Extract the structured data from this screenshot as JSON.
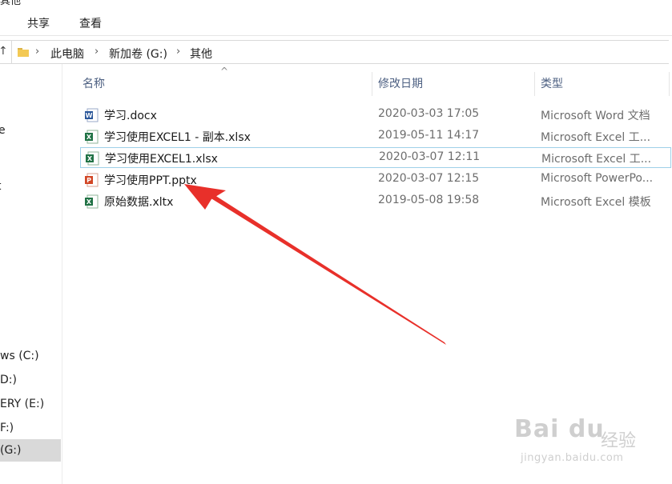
{
  "window": {
    "title_fragment": "其他"
  },
  "ribbon": {
    "tabs": [
      "共享",
      "查看"
    ]
  },
  "address": {
    "breadcrumbs": [
      "此电脑",
      "新加卷 (G:)",
      "其他"
    ]
  },
  "sidebar": {
    "fragments": [
      "e",
      "t"
    ],
    "drives": [
      {
        "label": "ws (C:)",
        "selected": false
      },
      {
        "label": "D:)",
        "selected": false
      },
      {
        "label": "ERY (E:)",
        "selected": false
      },
      {
        "label": "F:)",
        "selected": false
      },
      {
        "label": "(G:)",
        "selected": true
      }
    ]
  },
  "columns": {
    "name": "名称",
    "date": "修改日期",
    "type": "类型"
  },
  "files": [
    {
      "name": "学习.docx",
      "date": "2020-03-03 17:05",
      "type": "Microsoft Word 文档",
      "icon": "word-icon",
      "focused": false
    },
    {
      "name": "学习使用EXCEL1 - 副本.xlsx",
      "date": "2019-05-11 14:17",
      "type": "Microsoft Excel 工...",
      "icon": "excel-icon",
      "focused": false
    },
    {
      "name": "学习使用EXCEL1.xlsx",
      "date": "2020-03-07 12:11",
      "type": "Microsoft Excel 工...",
      "icon": "excel-icon",
      "focused": true
    },
    {
      "name": "学习使用PPT.pptx",
      "date": "2020-03-07 12:15",
      "type": "Microsoft PowerPo...",
      "icon": "powerpoint-icon",
      "focused": false
    },
    {
      "name": "原始数据.xltx",
      "date": "2019-05-08 19:58",
      "type": "Microsoft Excel 模板",
      "icon": "excel-template-icon",
      "focused": false
    }
  ],
  "watermark": {
    "logo": "Bai du",
    "text": "经验",
    "url": "jingyan.baidu.com"
  },
  "colors": {
    "annotation_arrow": "#e8302a",
    "header_text": "#4d6082",
    "selection": "#d9d9d9",
    "focus_border": "#9fd0e8"
  }
}
